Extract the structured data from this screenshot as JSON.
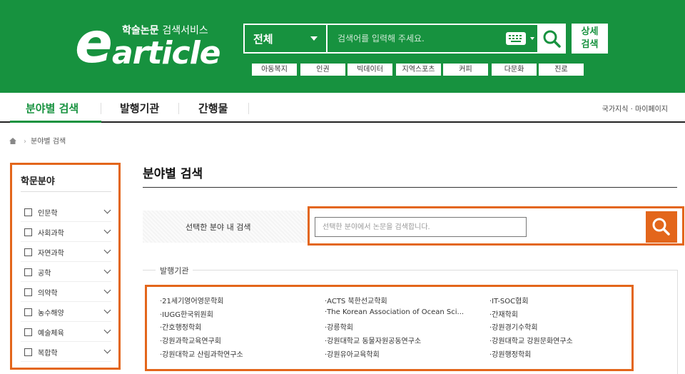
{
  "header": {
    "logo": {
      "big": "e",
      "word": "article",
      "sub_bold": "학술논문",
      "sub_light": "검색서비스"
    },
    "search": {
      "scope": "전체",
      "placeholder": "검색어를 입력해 주세요."
    },
    "advanced": [
      "상세",
      "검색"
    ],
    "keywords": [
      "아동복지",
      "인권",
      "빅데이터",
      "지역스포츠",
      "커피",
      "다문화",
      "진로"
    ]
  },
  "nav": {
    "tabs": [
      "분야별 검색",
      "발행기관",
      "간행물"
    ],
    "util": [
      "국가지식",
      "·",
      "마이페이지"
    ]
  },
  "breadcrumb": {
    "current": "분야별 검색"
  },
  "sidebar": {
    "title": "학문분야",
    "items": [
      "인문학",
      "사회과학",
      "자연과학",
      "공학",
      "의약학",
      "농수해양",
      "예술체육",
      "복합학"
    ]
  },
  "main": {
    "title": "분야별 검색",
    "field_search": {
      "label": "선택한 분야 내 검색",
      "placeholder": "선택한 분야에서 논문을 검색합니다."
    },
    "publishers": {
      "label": "발행기관",
      "items": [
        "·21세기영어영문학회",
        "·ACTS 북한선교학회",
        "·IT-SOC협회",
        "·IUGG한국위원회",
        "·The Korean Association of Ocean Sci...",
        "·간재학회",
        "·간호행정학회",
        "·강릉학회",
        "·강원경기수학회",
        "·강원과학교육연구회",
        "·강원대학교 동물자원공동연구소",
        "·강원대학교 강원문화연구소",
        "·강원대학교 산림과학연구소",
        "·강원유아교육학회",
        "·강원행정학회"
      ]
    }
  },
  "colors": {
    "brand_green": "#17923f",
    "highlight_orange": "#e3661b"
  }
}
